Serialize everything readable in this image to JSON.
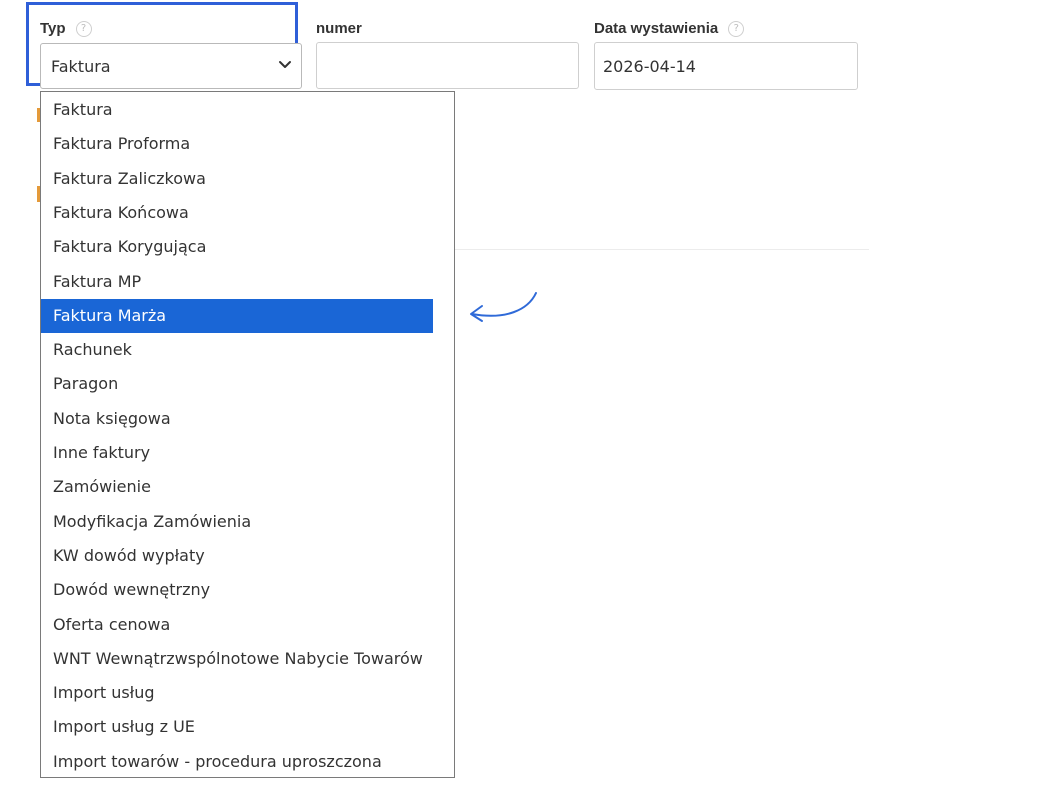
{
  "form": {
    "type_field": {
      "label": "Typ",
      "help_glyph": "?",
      "selected_value": "Faktura",
      "options": [
        "Faktura",
        "Faktura Proforma",
        "Faktura Zaliczkowa",
        "Faktura Końcowa",
        "Faktura Korygująca",
        "Faktura MP",
        "Faktura Marża",
        "Rachunek",
        "Paragon",
        "Nota księgowa",
        "Inne faktury",
        "Zamówienie",
        "Modyfikacja Zamówienia",
        "KW dowód wypłaty",
        "Dowód wewnętrzny",
        "Oferta cenowa",
        "WNT Wewnątrzwspólnotowe Nabycie Towarów",
        "Import usług",
        "Import usług z UE",
        "Import towarów - procedura uproszczona"
      ],
      "highlighted_option": "Faktura Marża"
    },
    "number_field": {
      "label": "numer",
      "value": ""
    },
    "date_field": {
      "label": "Data wystawienia",
      "help_glyph": "?",
      "value": "2026-04-14"
    }
  },
  "colors": {
    "highlight_border": "#2f5fd8",
    "selected_option_bg": "#1a66d6",
    "annotation_arrow": "#2f6ad8"
  },
  "icons": {
    "select_chevron": "chevron-down-icon",
    "help": "question-circle-icon",
    "annotation": "curved-arrow-left-icon"
  }
}
